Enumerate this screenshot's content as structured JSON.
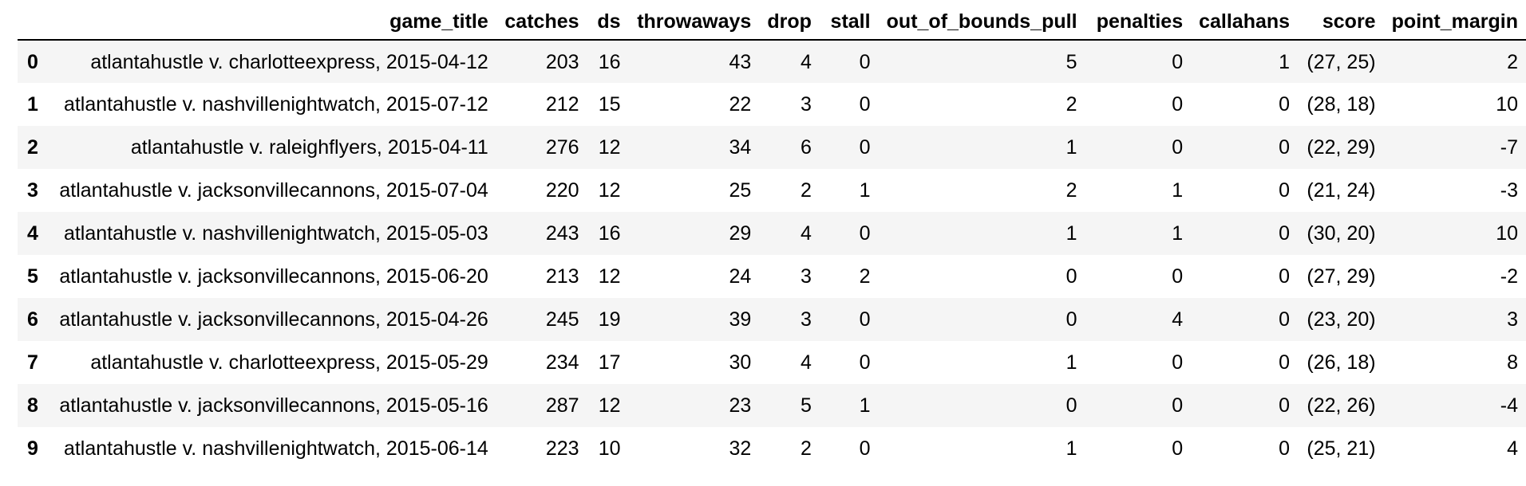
{
  "table": {
    "index_header": "",
    "columns": [
      "game_title",
      "catches",
      "ds",
      "throwaways",
      "drop",
      "stall",
      "out_of_bounds_pull",
      "penalties",
      "callahans",
      "score",
      "point_margin"
    ],
    "rows": [
      {
        "index": "0",
        "cells": [
          "atlantahustle v. charlotteexpress, 2015-04-12",
          "203",
          "16",
          "43",
          "4",
          "0",
          "5",
          "0",
          "1",
          "(27, 25)",
          "2"
        ]
      },
      {
        "index": "1",
        "cells": [
          "atlantahustle v. nashvillenightwatch, 2015-07-12",
          "212",
          "15",
          "22",
          "3",
          "0",
          "2",
          "0",
          "0",
          "(28, 18)",
          "10"
        ]
      },
      {
        "index": "2",
        "cells": [
          "atlantahustle v. raleighflyers, 2015-04-11",
          "276",
          "12",
          "34",
          "6",
          "0",
          "1",
          "0",
          "0",
          "(22, 29)",
          "-7"
        ]
      },
      {
        "index": "3",
        "cells": [
          "atlantahustle v. jacksonvillecannons, 2015-07-04",
          "220",
          "12",
          "25",
          "2",
          "1",
          "2",
          "1",
          "0",
          "(21, 24)",
          "-3"
        ]
      },
      {
        "index": "4",
        "cells": [
          "atlantahustle v. nashvillenightwatch, 2015-05-03",
          "243",
          "16",
          "29",
          "4",
          "0",
          "1",
          "1",
          "0",
          "(30, 20)",
          "10"
        ]
      },
      {
        "index": "5",
        "cells": [
          "atlantahustle v. jacksonvillecannons, 2015-06-20",
          "213",
          "12",
          "24",
          "3",
          "2",
          "0",
          "0",
          "0",
          "(27, 29)",
          "-2"
        ]
      },
      {
        "index": "6",
        "cells": [
          "atlantahustle v. jacksonvillecannons, 2015-04-26",
          "245",
          "19",
          "39",
          "3",
          "0",
          "0",
          "4",
          "0",
          "(23, 20)",
          "3"
        ]
      },
      {
        "index": "7",
        "cells": [
          "atlantahustle v. charlotteexpress, 2015-05-29",
          "234",
          "17",
          "30",
          "4",
          "0",
          "1",
          "0",
          "0",
          "(26, 18)",
          "8"
        ]
      },
      {
        "index": "8",
        "cells": [
          "atlantahustle v. jacksonvillecannons, 2015-05-16",
          "287",
          "12",
          "23",
          "5",
          "1",
          "0",
          "0",
          "0",
          "(22, 26)",
          "-4"
        ]
      },
      {
        "index": "9",
        "cells": [
          "atlantahustle v. nashvillenightwatch, 2015-06-14",
          "223",
          "10",
          "32",
          "2",
          "0",
          "1",
          "0",
          "0",
          "(25, 21)",
          "4"
        ]
      }
    ]
  }
}
